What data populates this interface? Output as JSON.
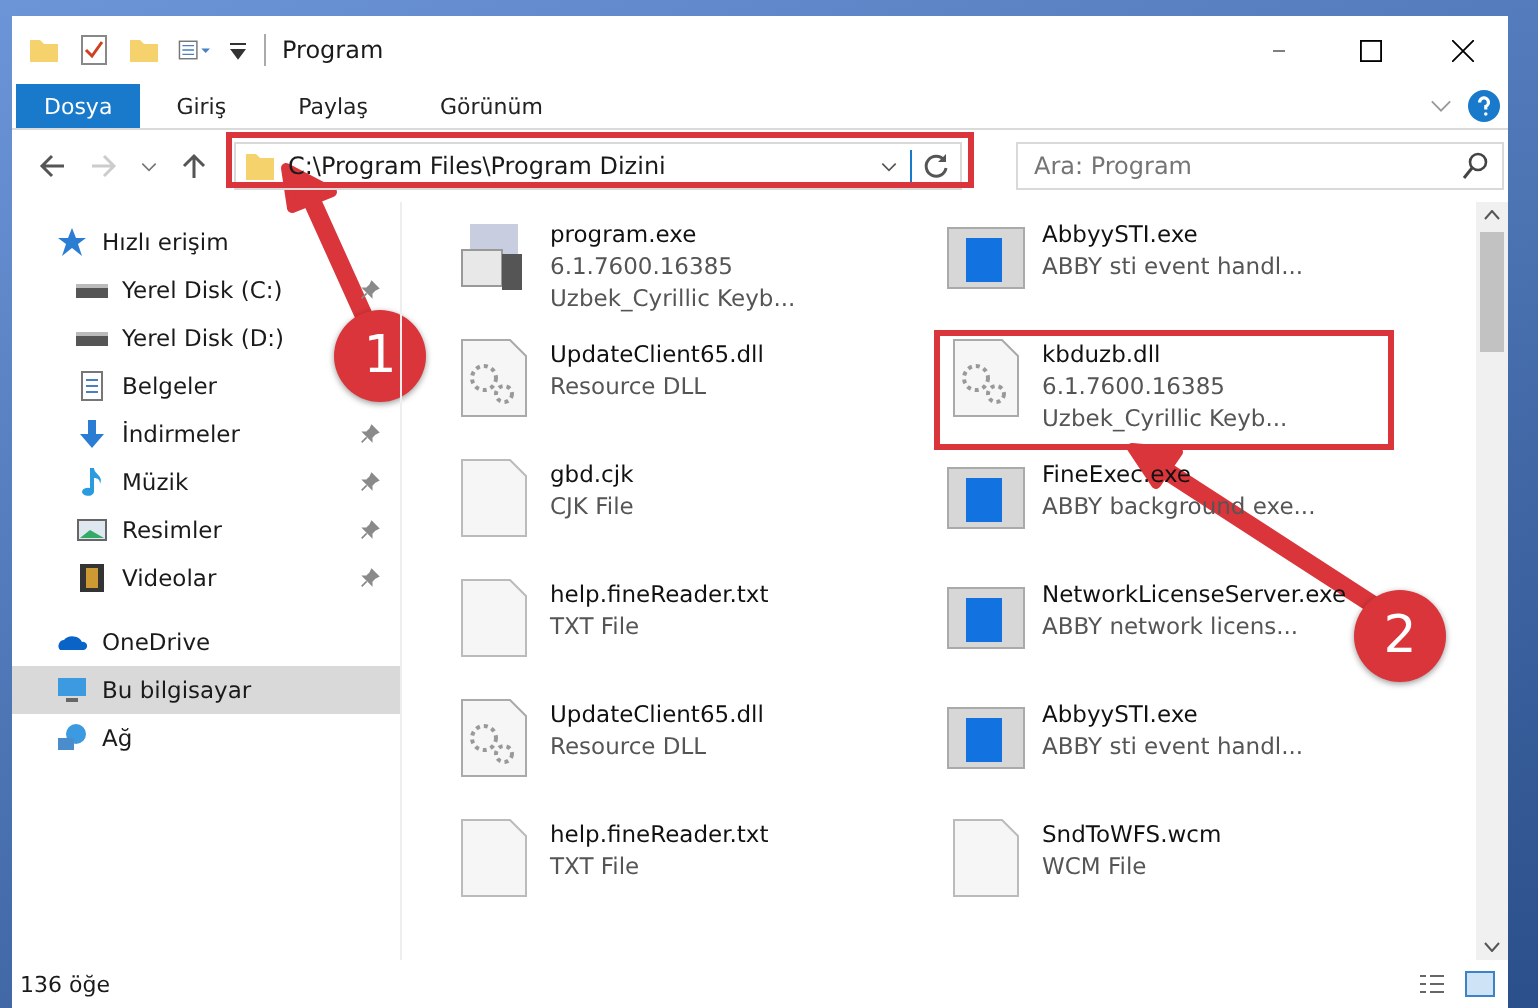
{
  "window": {
    "title": "Program"
  },
  "ribbon_tabs": [
    {
      "label": "Dosya",
      "selected": true
    },
    {
      "label": "Giriş",
      "selected": false
    },
    {
      "label": "Paylaş",
      "selected": false
    },
    {
      "label": "Görünüm",
      "selected": false
    }
  ],
  "address": {
    "value": "C:\\Program Files\\Program Dizini"
  },
  "search": {
    "placeholder": "Ara: Program"
  },
  "sidebar": {
    "items": [
      {
        "label": "Hızlı erişim",
        "kind": "star",
        "selected": false,
        "children": [
          {
            "label": "Yerel Disk (C:)",
            "kind": "drive",
            "pinned": true,
            "selected": false
          },
          {
            "label": "Yerel Disk (D:)",
            "kind": "drive",
            "pinned": false,
            "selected": false
          },
          {
            "label": "Belgeler",
            "kind": "docs",
            "pinned": false,
            "selected": false
          },
          {
            "label": "İndirmeler",
            "kind": "download",
            "pinned": true,
            "selected": false
          },
          {
            "label": "Müzik",
            "kind": "music",
            "pinned": true,
            "selected": false
          },
          {
            "label": "Resimler",
            "kind": "pictures",
            "pinned": true,
            "selected": false
          },
          {
            "label": "Videolar",
            "kind": "videos",
            "pinned": true,
            "selected": false
          }
        ]
      },
      {
        "label": "OneDrive",
        "kind": "cloud",
        "selected": false
      },
      {
        "label": "Bu bilgisayar",
        "kind": "pc",
        "selected": true
      },
      {
        "label": "Ağ",
        "kind": "network",
        "selected": false
      }
    ]
  },
  "files": [
    {
      "name": "program.exe",
      "lines": [
        "6.1.7600.16385",
        "Uzbek_Cyrillic Keyb..."
      ],
      "kind": "app",
      "selected": false
    },
    {
      "name": "AbbyySTI.exe",
      "lines": [
        "ABBY sti event handl..."
      ],
      "kind": "exe",
      "selected": false
    },
    {
      "name": "UpdateClient65.dll",
      "lines": [
        "Resource DLL"
      ],
      "kind": "dll",
      "selected": false
    },
    {
      "name": "kbduzb.dll",
      "lines": [
        "6.1.7600.16385",
        "Uzbek_Cyrillic Keyb..."
      ],
      "kind": "dll",
      "selected": true
    },
    {
      "name": "gbd.cjk",
      "lines": [
        "CJK File"
      ],
      "kind": "doc",
      "selected": false
    },
    {
      "name": "FineExec.exe",
      "lines": [
        "ABBY background exe..."
      ],
      "kind": "exe",
      "selected": false
    },
    {
      "name": "help.fineReader.txt",
      "lines": [
        "TXT File"
      ],
      "kind": "doc",
      "selected": false
    },
    {
      "name": "NetworkLicenseServer.exe",
      "lines": [
        "ABBY network licens..."
      ],
      "kind": "exe",
      "selected": false
    },
    {
      "name": "UpdateClient65.dll",
      "lines": [
        "Resource DLL"
      ],
      "kind": "dll",
      "selected": false
    },
    {
      "name": "AbbyySTI.exe",
      "lines": [
        "ABBY sti event handl..."
      ],
      "kind": "exe",
      "selected": false
    },
    {
      "name": "help.fineReader.txt",
      "lines": [
        "TXT File"
      ],
      "kind": "doc",
      "selected": false
    },
    {
      "name": "SndToWFS.wcm",
      "lines": [
        "WCM File"
      ],
      "kind": "doc",
      "selected": false
    }
  ],
  "status_bar": {
    "count": "136 öğe"
  },
  "annotations": [
    {
      "number": "1"
    },
    {
      "number": "2"
    }
  ]
}
